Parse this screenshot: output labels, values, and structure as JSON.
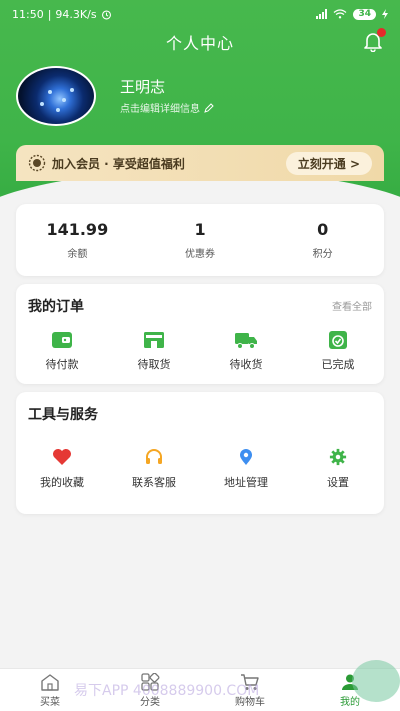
{
  "status_bar": {
    "time": "11:50",
    "speed": "94.3K/s",
    "battery": "34"
  },
  "header": {
    "title": "个人中心",
    "username": "王明志",
    "edit_info": "点击编辑详细信息"
  },
  "vip": {
    "text": "加入会员 · 享受超值福利",
    "button": "立刻开通 >"
  },
  "stats": [
    {
      "value": "141.99",
      "label": "余额"
    },
    {
      "value": "1",
      "label": "优惠券"
    },
    {
      "value": "0",
      "label": "积分"
    }
  ],
  "orders": {
    "title": "我的订单",
    "view_all": "查看全部",
    "items": [
      {
        "label": "待付款",
        "icon": "wallet-icon"
      },
      {
        "label": "待取货",
        "icon": "store-icon"
      },
      {
        "label": "待收货",
        "icon": "truck-icon"
      },
      {
        "label": "已完成",
        "icon": "check-icon"
      }
    ]
  },
  "tools": {
    "title": "工具与服务",
    "items": [
      {
        "label": "我的收藏",
        "icon": "heart-icon"
      },
      {
        "label": "联系客服",
        "icon": "headset-icon"
      },
      {
        "label": "地址管理",
        "icon": "location-icon"
      },
      {
        "label": "设置",
        "icon": "gear-icon"
      }
    ]
  },
  "tabbar": {
    "items": [
      {
        "label": "买菜",
        "icon": "home-icon"
      },
      {
        "label": "分类",
        "icon": "category-icon"
      },
      {
        "label": "购物车",
        "icon": "cart-icon"
      },
      {
        "label": "我的",
        "icon": "user-icon"
      }
    ],
    "active_index": 3
  },
  "watermark": "易下APP 4008889900.COM",
  "colors": {
    "primary_green": "#3fb449",
    "accent_green": "#2a9a35",
    "vip_gold": "#f0d9a8",
    "badge_red": "#e52a2a"
  }
}
